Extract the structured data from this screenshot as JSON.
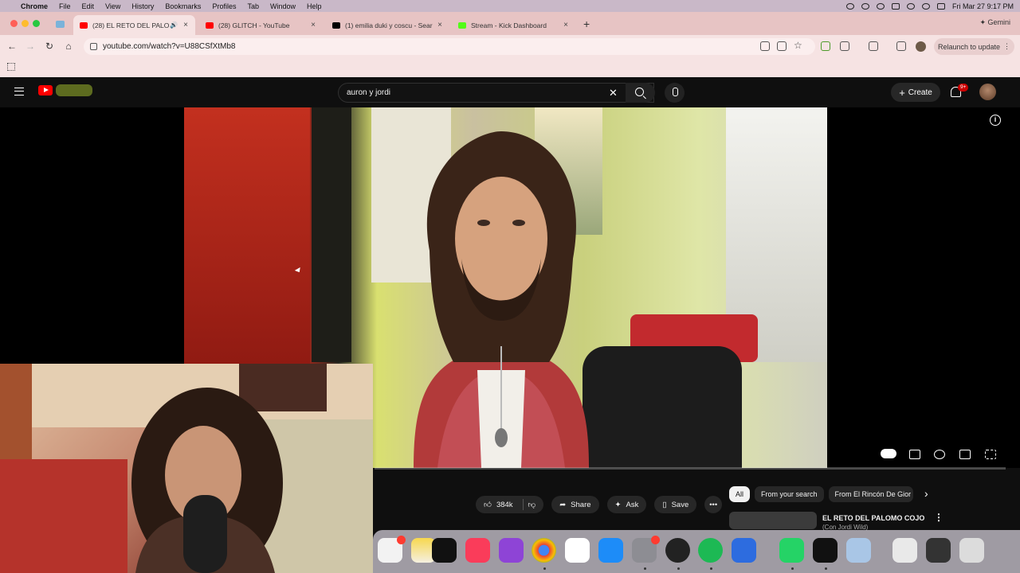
{
  "menubar": {
    "app": "Chrome",
    "items": [
      "File",
      "Edit",
      "View",
      "History",
      "Bookmarks",
      "Profiles",
      "Tab",
      "Window",
      "Help"
    ],
    "clock": "Fri Mar 27  9:17 PM"
  },
  "tabs": [
    {
      "title": "(28) EL RETO DEL PALOM",
      "active": true
    },
    {
      "title": "(28) GLITCH - YouTube",
      "active": false
    },
    {
      "title": "(1) emilia duki y coscu - Sear",
      "active": false
    },
    {
      "title": "Stream - Kick Dashboard",
      "active": false
    }
  ],
  "gemini_label": "Gemini",
  "address": {
    "url": "youtube.com/watch?v=U88CSfXtMb8"
  },
  "relaunch_label": "Relaunch to update",
  "youtube": {
    "search_value": "auron y jordi",
    "create_label": "Create",
    "notifications_badge": "9+",
    "actions": {
      "likes": "384k",
      "share": "Share",
      "ask": "Ask",
      "save": "Save"
    },
    "chips": [
      "All",
      "From your search",
      "From El Rincón De Gior"
    ],
    "recommendation": {
      "title": "EL RETO DEL PALOMO COJO",
      "subtitle": "(Con Jordi Wild)"
    }
  },
  "colors": {
    "youtube_red": "#ff0000",
    "youtube_bg": "#0f0f0f",
    "chrome_frame": "#e7c4c4",
    "menubar": "#c9b8c8"
  },
  "icons": {
    "menu": "hamburger-icon",
    "search": "search-icon",
    "mic": "mic-icon",
    "bell": "bell-icon",
    "like": "thumbs-up-icon",
    "dislike": "thumbs-down-icon",
    "share": "share-arrow-icon",
    "ask": "sparkle-icon",
    "save": "bookmark-icon"
  }
}
